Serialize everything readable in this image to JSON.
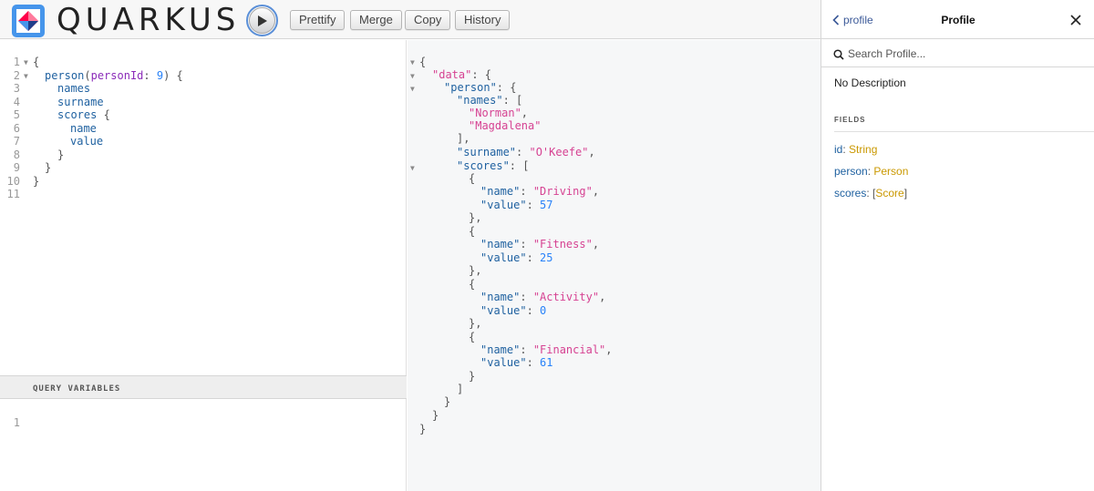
{
  "topbar": {
    "logo_text": "QUARKUS",
    "buttons": {
      "prettify": "Prettify",
      "merge": "Merge",
      "copy": "Copy",
      "history": "History"
    }
  },
  "query_editor": {
    "line_numbers": [
      "1",
      "2",
      "3",
      "4",
      "5",
      "6",
      "7",
      "8",
      "9",
      "10",
      "11"
    ],
    "lines": {
      "l1": "{",
      "l2_field": "person",
      "l2_arg": "personId",
      "l2_val": "9",
      "l3": "names",
      "l4": "surname",
      "l5": "scores",
      "l6": "name",
      "l7": "value"
    }
  },
  "variables": {
    "label": "QUERY VARIABLES",
    "line_numbers": [
      "1"
    ]
  },
  "result": {
    "data_key": "\"data\"",
    "person_key": "\"person\"",
    "names_key": "\"names\"",
    "names": [
      "\"Norman\"",
      "\"Magdalena\""
    ],
    "surname_key": "\"surname\"",
    "surname": "\"O'Keefe\"",
    "scores_key": "\"scores\"",
    "name_key": "\"name\"",
    "value_key": "\"value\"",
    "scores": [
      {
        "name": "\"Driving\"",
        "value": "57"
      },
      {
        "name": "\"Fitness\"",
        "value": "25"
      },
      {
        "name": "\"Activity\"",
        "value": "0"
      },
      {
        "name": "\"Financial\"",
        "value": "61"
      }
    ]
  },
  "docs": {
    "back_label": "profile",
    "title": "Profile",
    "search_placeholder": "Search Profile...",
    "description": "No Description",
    "fields_label": "FIELDS",
    "fields": [
      {
        "name": "id",
        "type": "String",
        "list": false
      },
      {
        "name": "person",
        "type": "Person",
        "list": false
      },
      {
        "name": "scores",
        "type": "Score",
        "list": true
      }
    ]
  },
  "colors": {
    "accent": "#3b5998",
    "type_color": "#ca9800",
    "string_color": "#d64292"
  }
}
